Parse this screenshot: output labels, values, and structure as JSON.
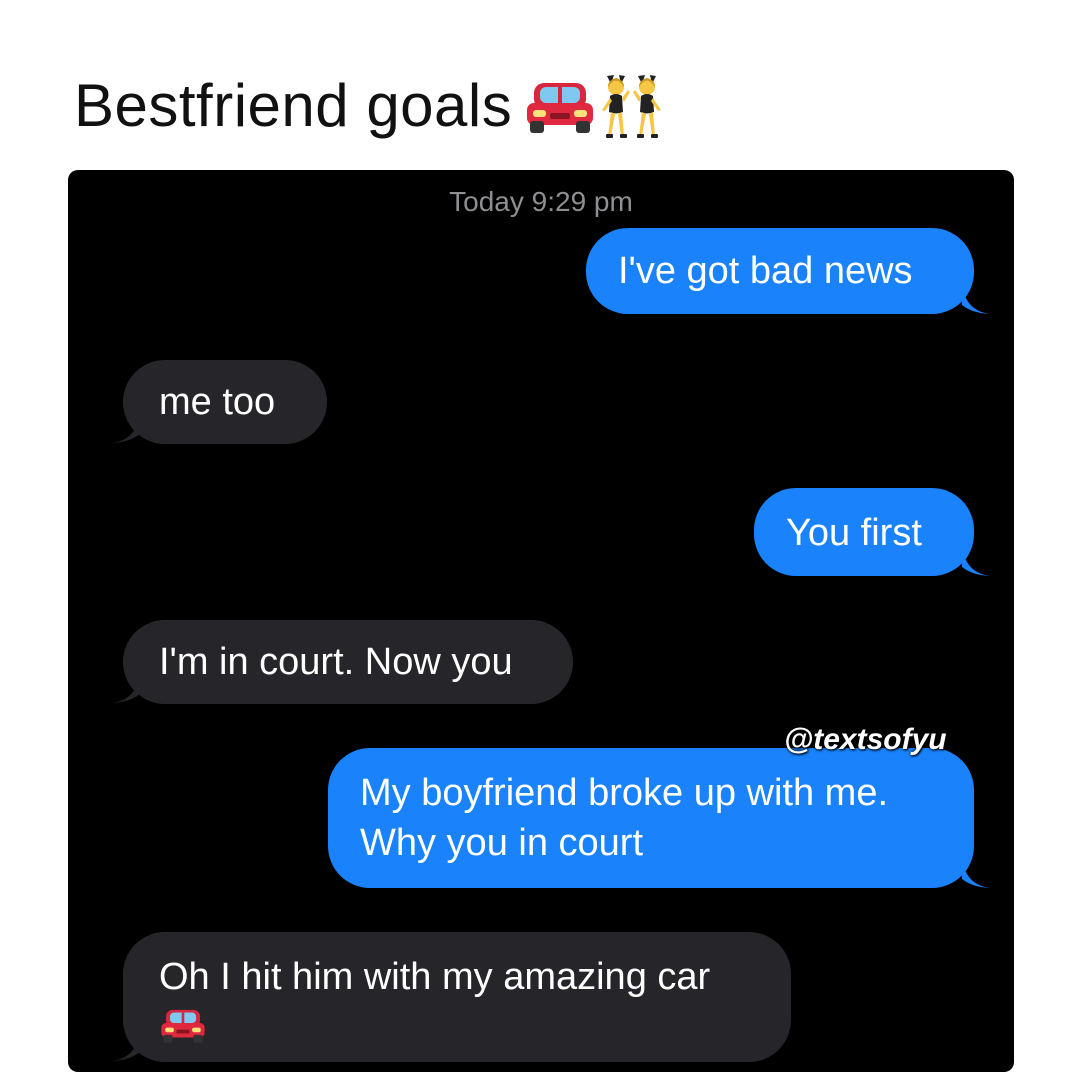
{
  "caption": {
    "text": "Bestfriend goals",
    "emojis": [
      "car-emoji",
      "dancing-women-emoji"
    ]
  },
  "conversation": {
    "timestamp_day": "Today",
    "timestamp_time": "9:29 pm",
    "messages": [
      {
        "direction": "sent",
        "text": "I've got bad news"
      },
      {
        "direction": "received",
        "text": "me too"
      },
      {
        "direction": "sent",
        "text": "You first"
      },
      {
        "direction": "received",
        "text": "I'm in court. Now you"
      },
      {
        "direction": "sent",
        "line1": "My boyfriend broke up with me.",
        "line2": "Why you in court"
      },
      {
        "direction": "received",
        "text": "Oh I hit him with my amazing car",
        "emoji": "car-emoji"
      }
    ]
  },
  "watermark": "@textsofyu",
  "colors": {
    "sent_bubble": "#1a82fb",
    "received_bubble": "#26252a",
    "chat_background": "#000000"
  }
}
